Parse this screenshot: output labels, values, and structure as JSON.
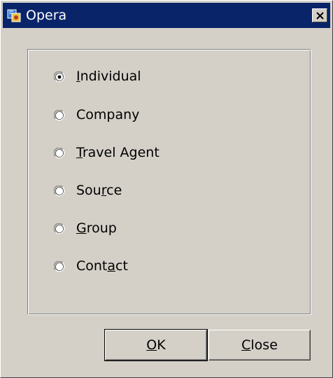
{
  "window": {
    "title": "Opera",
    "icon": "opera-app-icon",
    "close_icon": "close-icon"
  },
  "options": [
    {
      "label": "Individual",
      "mnemonic_index": 0,
      "selected": true
    },
    {
      "label": "Company",
      "mnemonic_index": -1,
      "selected": false
    },
    {
      "label": "Travel Agent",
      "mnemonic_index": 0,
      "selected": false
    },
    {
      "label": "Source",
      "mnemonic_index": 3,
      "selected": false
    },
    {
      "label": "Group",
      "mnemonic_index": 0,
      "selected": false
    },
    {
      "label": "Contact",
      "mnemonic_index": 4,
      "selected": false
    }
  ],
  "buttons": {
    "ok_label": "OK",
    "close_label": "Close"
  }
}
